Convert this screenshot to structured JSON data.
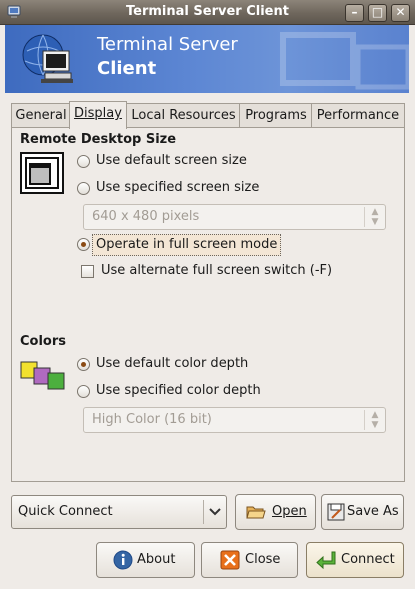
{
  "window": {
    "title": "Terminal Server Client"
  },
  "banner": {
    "line1": "Terminal Server",
    "line2": "Client"
  },
  "tabs": [
    "General",
    "Display",
    "Local Resources",
    "Programs",
    "Performance"
  ],
  "remote_desktop": {
    "heading": "Remote Desktop Size",
    "opt_default": "Use default screen size",
    "opt_specified": "Use specified screen size",
    "size_value": "640 x 480 pixels",
    "opt_fullscreen": "Operate in full screen mode",
    "alt_switch": "Use alternate full screen switch (-F)",
    "selected": "fullscreen"
  },
  "colors": {
    "heading": "Colors",
    "opt_default": "Use default color depth",
    "opt_specified": "Use specified color depth",
    "depth_value": "High Color (16 bit)",
    "selected": "default"
  },
  "quick_connect": {
    "value": "Quick Connect"
  },
  "buttons": {
    "open": "Open",
    "save_as": "Save As",
    "about": "About",
    "close": "Close",
    "connect": "Connect"
  },
  "icons": [
    "terminal-app-icon",
    "computer-globe-icon",
    "screen-size-icon",
    "color-depth-icon",
    "folder-open-icon",
    "save-icon",
    "info-icon",
    "close-icon",
    "connect-arrow-icon"
  ]
}
